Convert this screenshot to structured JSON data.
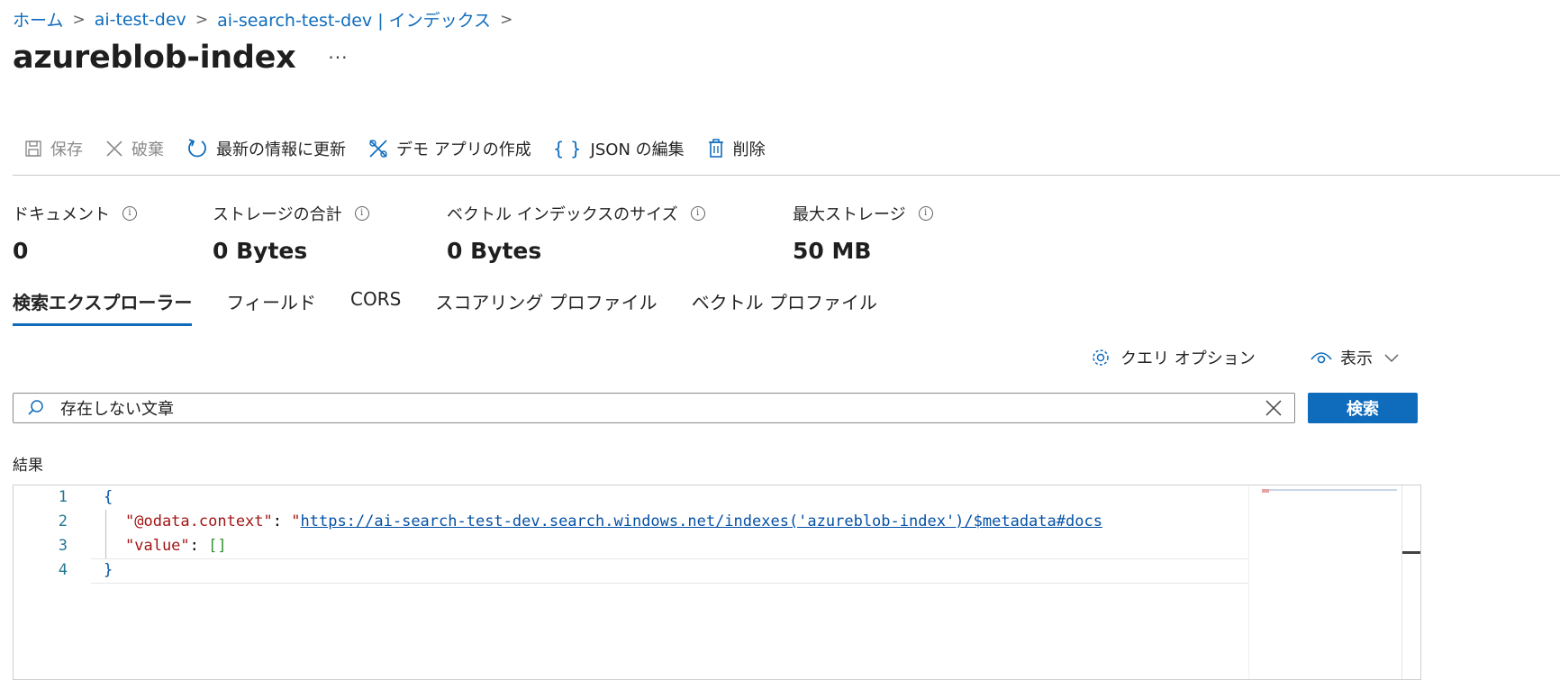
{
  "breadcrumb": {
    "items": [
      "ホーム",
      "ai-test-dev",
      "ai-search-test-dev | インデックス"
    ]
  },
  "page": {
    "title": "azureblob-index",
    "more": "···"
  },
  "toolbar": {
    "save": "保存",
    "discard": "破棄",
    "refresh": "最新の情報に更新",
    "demo_app": "デモ アプリの作成",
    "edit_json": "JSON の編集",
    "delete": "削除"
  },
  "stats": [
    {
      "label": "ドキュメント",
      "value": "0"
    },
    {
      "label": "ストレージの合計",
      "value": "0 Bytes"
    },
    {
      "label": "ベクトル インデックスのサイズ",
      "value": "0 Bytes"
    },
    {
      "label": "最大ストレージ",
      "value": "50 MB"
    }
  ],
  "tabs": [
    "検索エクスプローラー",
    "フィールド",
    "CORS",
    "スコアリング プロファイル",
    "ベクトル プロファイル"
  ],
  "query": {
    "options_label": "クエリ オプション",
    "view_label": "表示",
    "search_value": "存在しない文章",
    "search_button": "検索"
  },
  "results": {
    "label": "結果",
    "lines": [
      {
        "num": "1",
        "open": "{"
      },
      {
        "num": "2",
        "key": "\"@odata.context\"",
        "sep": ": ",
        "quote": "\"",
        "url": "https://ai-search-test-dev.search.windows.net/indexes('azureblob-index')/$metadata#docs"
      },
      {
        "num": "3",
        "key": "\"value\"",
        "sep": ": ",
        "arr": "[]"
      },
      {
        "num": "4",
        "close": "}"
      }
    ]
  },
  "colors": {
    "accent": "#0f6cbd"
  }
}
